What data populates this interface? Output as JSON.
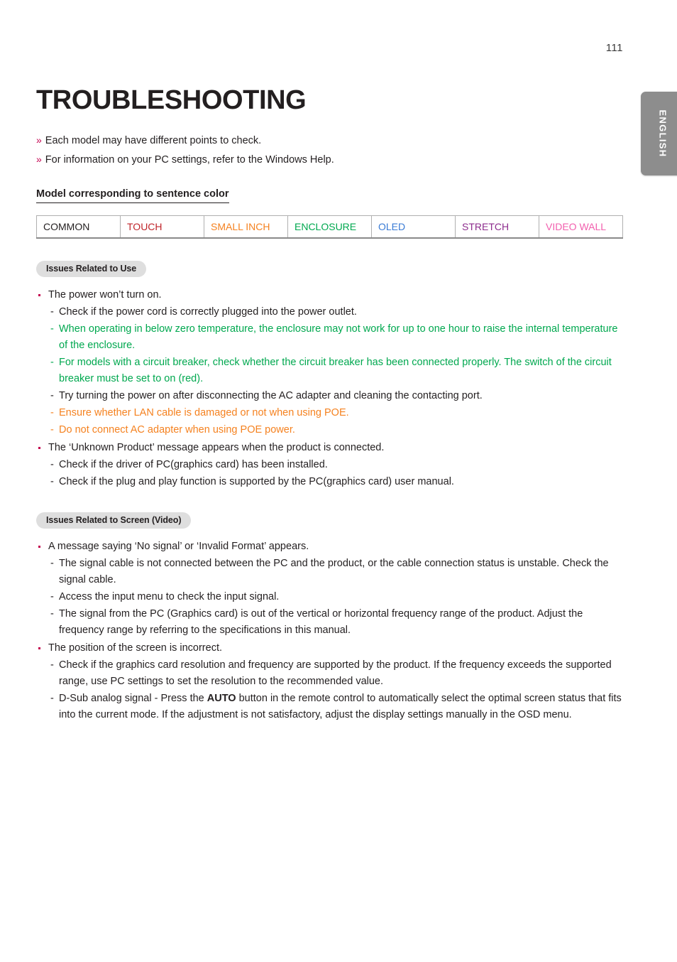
{
  "page_number": "111",
  "language_tab": {
    "label": "ENGLISH"
  },
  "title": "TROUBLESHOOTING",
  "intro": {
    "marker": "»",
    "lines": [
      "Each model may have different points to check.",
      "For information on your PC settings, refer to the Windows Help."
    ]
  },
  "sub_heading": "Model corresponding to sentence color",
  "legend": {
    "cells": [
      {
        "label": "COMMON",
        "color": "#231f20"
      },
      {
        "label": "TOUCH",
        "color": "#c0262c"
      },
      {
        "label": "SMALL INCH",
        "color": "#f58220"
      },
      {
        "label": "ENCLOSURE",
        "color": "#00a84f"
      },
      {
        "label": "OLED",
        "color": "#3a7bd5"
      },
      {
        "label": "STRETCH",
        "color": "#8e2d8e"
      },
      {
        "label": "VIDEO WALL",
        "color": "#f25fae"
      }
    ]
  },
  "sections": [
    {
      "badge": "Issues Related to Use",
      "items": [
        {
          "text": "The power won’t turn on.",
          "color": "common",
          "subitems": [
            {
              "text": "Check if the power cord is correctly plugged into the power outlet.",
              "color": "common"
            },
            {
              "text": "When operating in below zero temperature, the enclosure may not work for up to one hour to raise the internal temperature of the enclosure.",
              "color": "enclosure"
            },
            {
              "text": "For models with a circuit breaker, check whether the circuit breaker has been connected properly. The switch of the circuit breaker must be set to on (red).",
              "color": "enclosure"
            },
            {
              "text": "Try turning the power on after disconnecting the AC adapter and cleaning the contacting port.",
              "color": "common"
            },
            {
              "text": "Ensure whether LAN cable is damaged or not when using POE.",
              "color": "smallinch"
            },
            {
              "text": "Do not connect AC adapter when using POE power.",
              "color": "smallinch"
            }
          ]
        },
        {
          "text": "The ‘Unknown Product’ message appears when the product is connected.",
          "color": "common",
          "subitems": [
            {
              "text": "Check if the driver of PC(graphics card) has been installed.",
              "color": "common"
            },
            {
              "text": "Check if the plug and play function is supported by the PC(graphics card) user manual.",
              "color": "common"
            }
          ]
        }
      ]
    },
    {
      "badge": "Issues Related to Screen (Video)",
      "items": [
        {
          "text": "A message saying ‘No signal’ or ‘Invalid Format’ appears.",
          "color": "common",
          "subitems": [
            {
              "text": "The signal cable is not connected between the PC and the product, or the cable connection status is unstable. Check the signal cable.",
              "color": "common"
            },
            {
              "text": "Access the input menu to check the input signal.",
              "color": "common"
            },
            {
              "text": "The signal from the PC (Graphics card) is out of the vertical or horizontal frequency range of the product. Adjust the frequency range by referring to the specifications in this manual.",
              "color": "common"
            }
          ]
        },
        {
          "text": "The position of the screen is incorrect.",
          "color": "common",
          "subitems": [
            {
              "text": "Check if the graphics card resolution and frequency are supported by the product. If the frequency exceeds the supported range, use PC settings to set the resolution to the recommended value.",
              "color": "common"
            },
            {
              "text": "D-Sub analog signal - Press the AUTO button in the remote control to automatically select the optimal screen status that fits into the current mode. If the adjustment is not satisfactory, adjust the display settings manually in the OSD menu.",
              "color": "common",
              "bold_words": [
                "AUTO"
              ]
            }
          ]
        }
      ]
    }
  ]
}
